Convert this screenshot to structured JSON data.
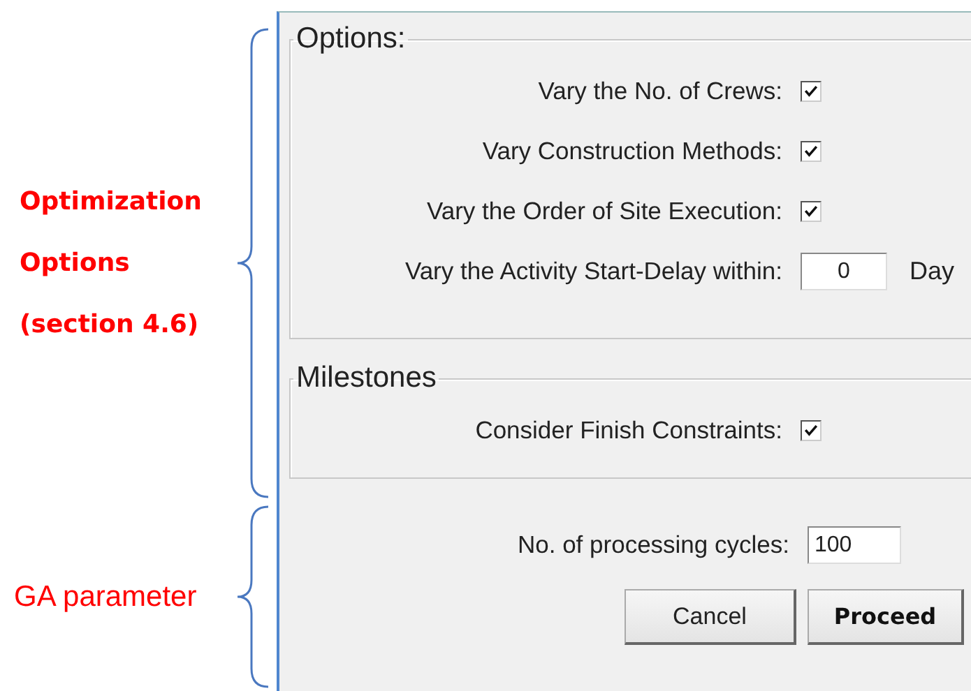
{
  "annotations": [
    {
      "lines": [
        "Optimization",
        "Options",
        "(section 4.6)"
      ],
      "bold": true
    },
    {
      "lines": [
        "GA parameter"
      ],
      "bold": false
    }
  ],
  "dialog": {
    "groups": [
      {
        "title": "Options:",
        "items": [
          {
            "kind": "checkbox",
            "label": "Vary the No. of Crews:",
            "checked": true
          },
          {
            "kind": "checkbox",
            "label": "Vary Construction Methods:",
            "checked": true
          },
          {
            "kind": "checkbox",
            "label": "Vary the Order of Site Execution:",
            "checked": true
          },
          {
            "kind": "number",
            "label": "Vary the Activity Start-Delay within:",
            "value": "0",
            "unit": "Day"
          }
        ]
      },
      {
        "title": "Milestones",
        "items": [
          {
            "kind": "checkbox",
            "label": "Consider Finish Constraints:",
            "checked": true
          }
        ]
      }
    ],
    "cycles": {
      "label": "No. of processing cycles:",
      "value": "100"
    },
    "buttons": [
      {
        "label": "Cancel",
        "default": false
      },
      {
        "label": "Proceed",
        "default": true
      }
    ]
  }
}
